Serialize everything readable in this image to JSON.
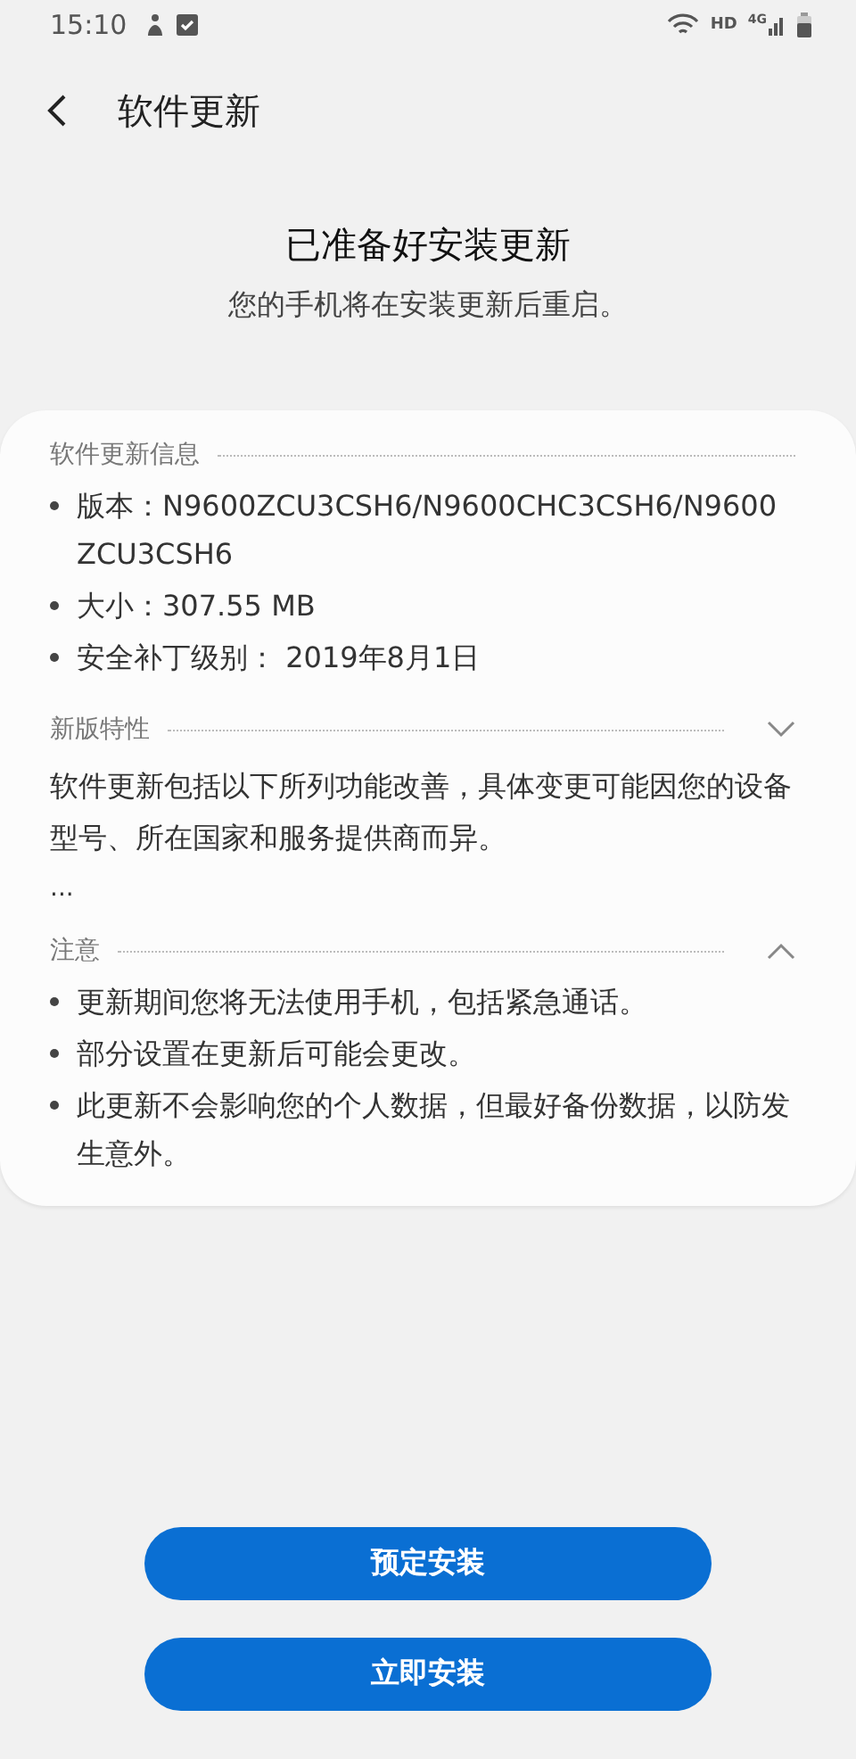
{
  "status_bar": {
    "time": "15:10",
    "network_hd": "HD",
    "network_4g": "4G"
  },
  "header": {
    "title": "软件更新"
  },
  "hero": {
    "title": "已准备好安装更新",
    "subtitle": "您的手机将在安装更新后重启。"
  },
  "sections": [
    {
      "kind": "bullets",
      "title": "软件更新信息",
      "items": [
        "版本：N9600ZCU3CSH6/N9600CHC3CSH6/N9600ZCU3CSH6",
        "大小：307.55 MB",
        "安全补丁级别： 2019年8月1日"
      ]
    },
    {
      "kind": "paragraph",
      "title": "新版特性",
      "expanded": false,
      "text": "软件更新包括以下所列功能改善，具体变更可能因您的设备型号、所在国家和服务提供商而异。",
      "more": "..."
    },
    {
      "kind": "bullets",
      "title": "注意",
      "expanded": true,
      "items": [
        "更新期间您将无法使用手机，包括紧急通话。",
        "部分设置在更新后可能会更改。",
        "此更新不会影响您的个人数据，但最好备份数据，以防发生意外。"
      ]
    }
  ],
  "buttons": [
    "预定安装",
    "立即安装"
  ]
}
